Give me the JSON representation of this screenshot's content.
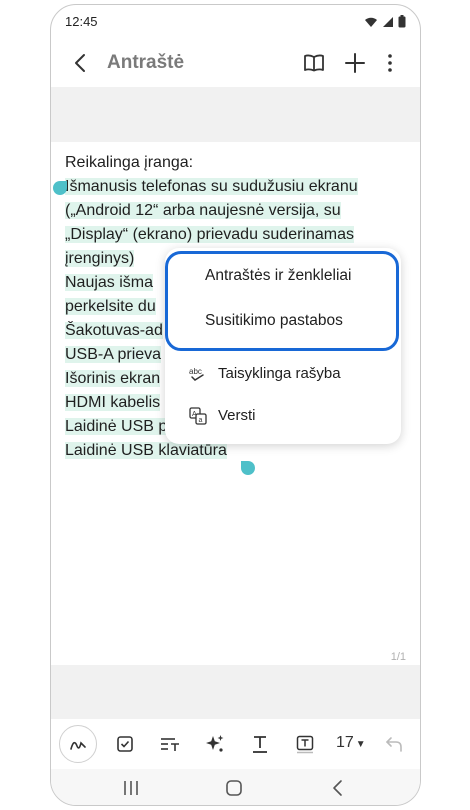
{
  "status_bar": {
    "time": "12:45"
  },
  "app_bar": {
    "title": "Antraštė"
  },
  "note": {
    "lines": [
      {
        "text": "Reikalinga įranga:",
        "rest": ""
      },
      {
        "text": "Išmanusis telefonas su sudužusiu ekranu",
        "rest": ""
      },
      {
        "text": "(„Android 12“ arba naujesnė versija, su",
        "rest": ""
      },
      {
        "text": "„Display“ (ekrano) prievadu suderinamas",
        "rest": ""
      },
      {
        "text": "įrenginys)",
        "rest": ""
      },
      {
        "text": "Naujas išma",
        "rest": ""
      },
      {
        "text": "perkelsite du",
        "rest": ""
      },
      {
        "text": "Šakotuvas-ad",
        "rest": ""
      },
      {
        "text": "USB-A prieva",
        "rest": ""
      },
      {
        "text": "Išorinis ekran",
        "rest": ""
      },
      {
        "text": "HDMI kabelis",
        "rest": ""
      },
      {
        "text": "Laidinė USB p",
        "rest": ""
      },
      {
        "text": "Laidinė USB klaviatūra",
        "rest": ""
      }
    ]
  },
  "context_menu": {
    "items": [
      {
        "label": "Antraštės ir ženkleliai",
        "icon": "none"
      },
      {
        "label": "Susitikimo pastabos",
        "icon": "none"
      },
      {
        "label": "Taisyklinga rašyba",
        "icon": "spellcheck-icon"
      },
      {
        "label": "Versti",
        "icon": "translate-icon"
      }
    ],
    "highlight_color": "#1868d6"
  },
  "page_indicator": "1/1",
  "toolbar": {
    "font_size": "17"
  },
  "colors": {
    "selection": "#dff4ec",
    "handle": "#4ec0c9",
    "band": "#f1f1f1"
  }
}
